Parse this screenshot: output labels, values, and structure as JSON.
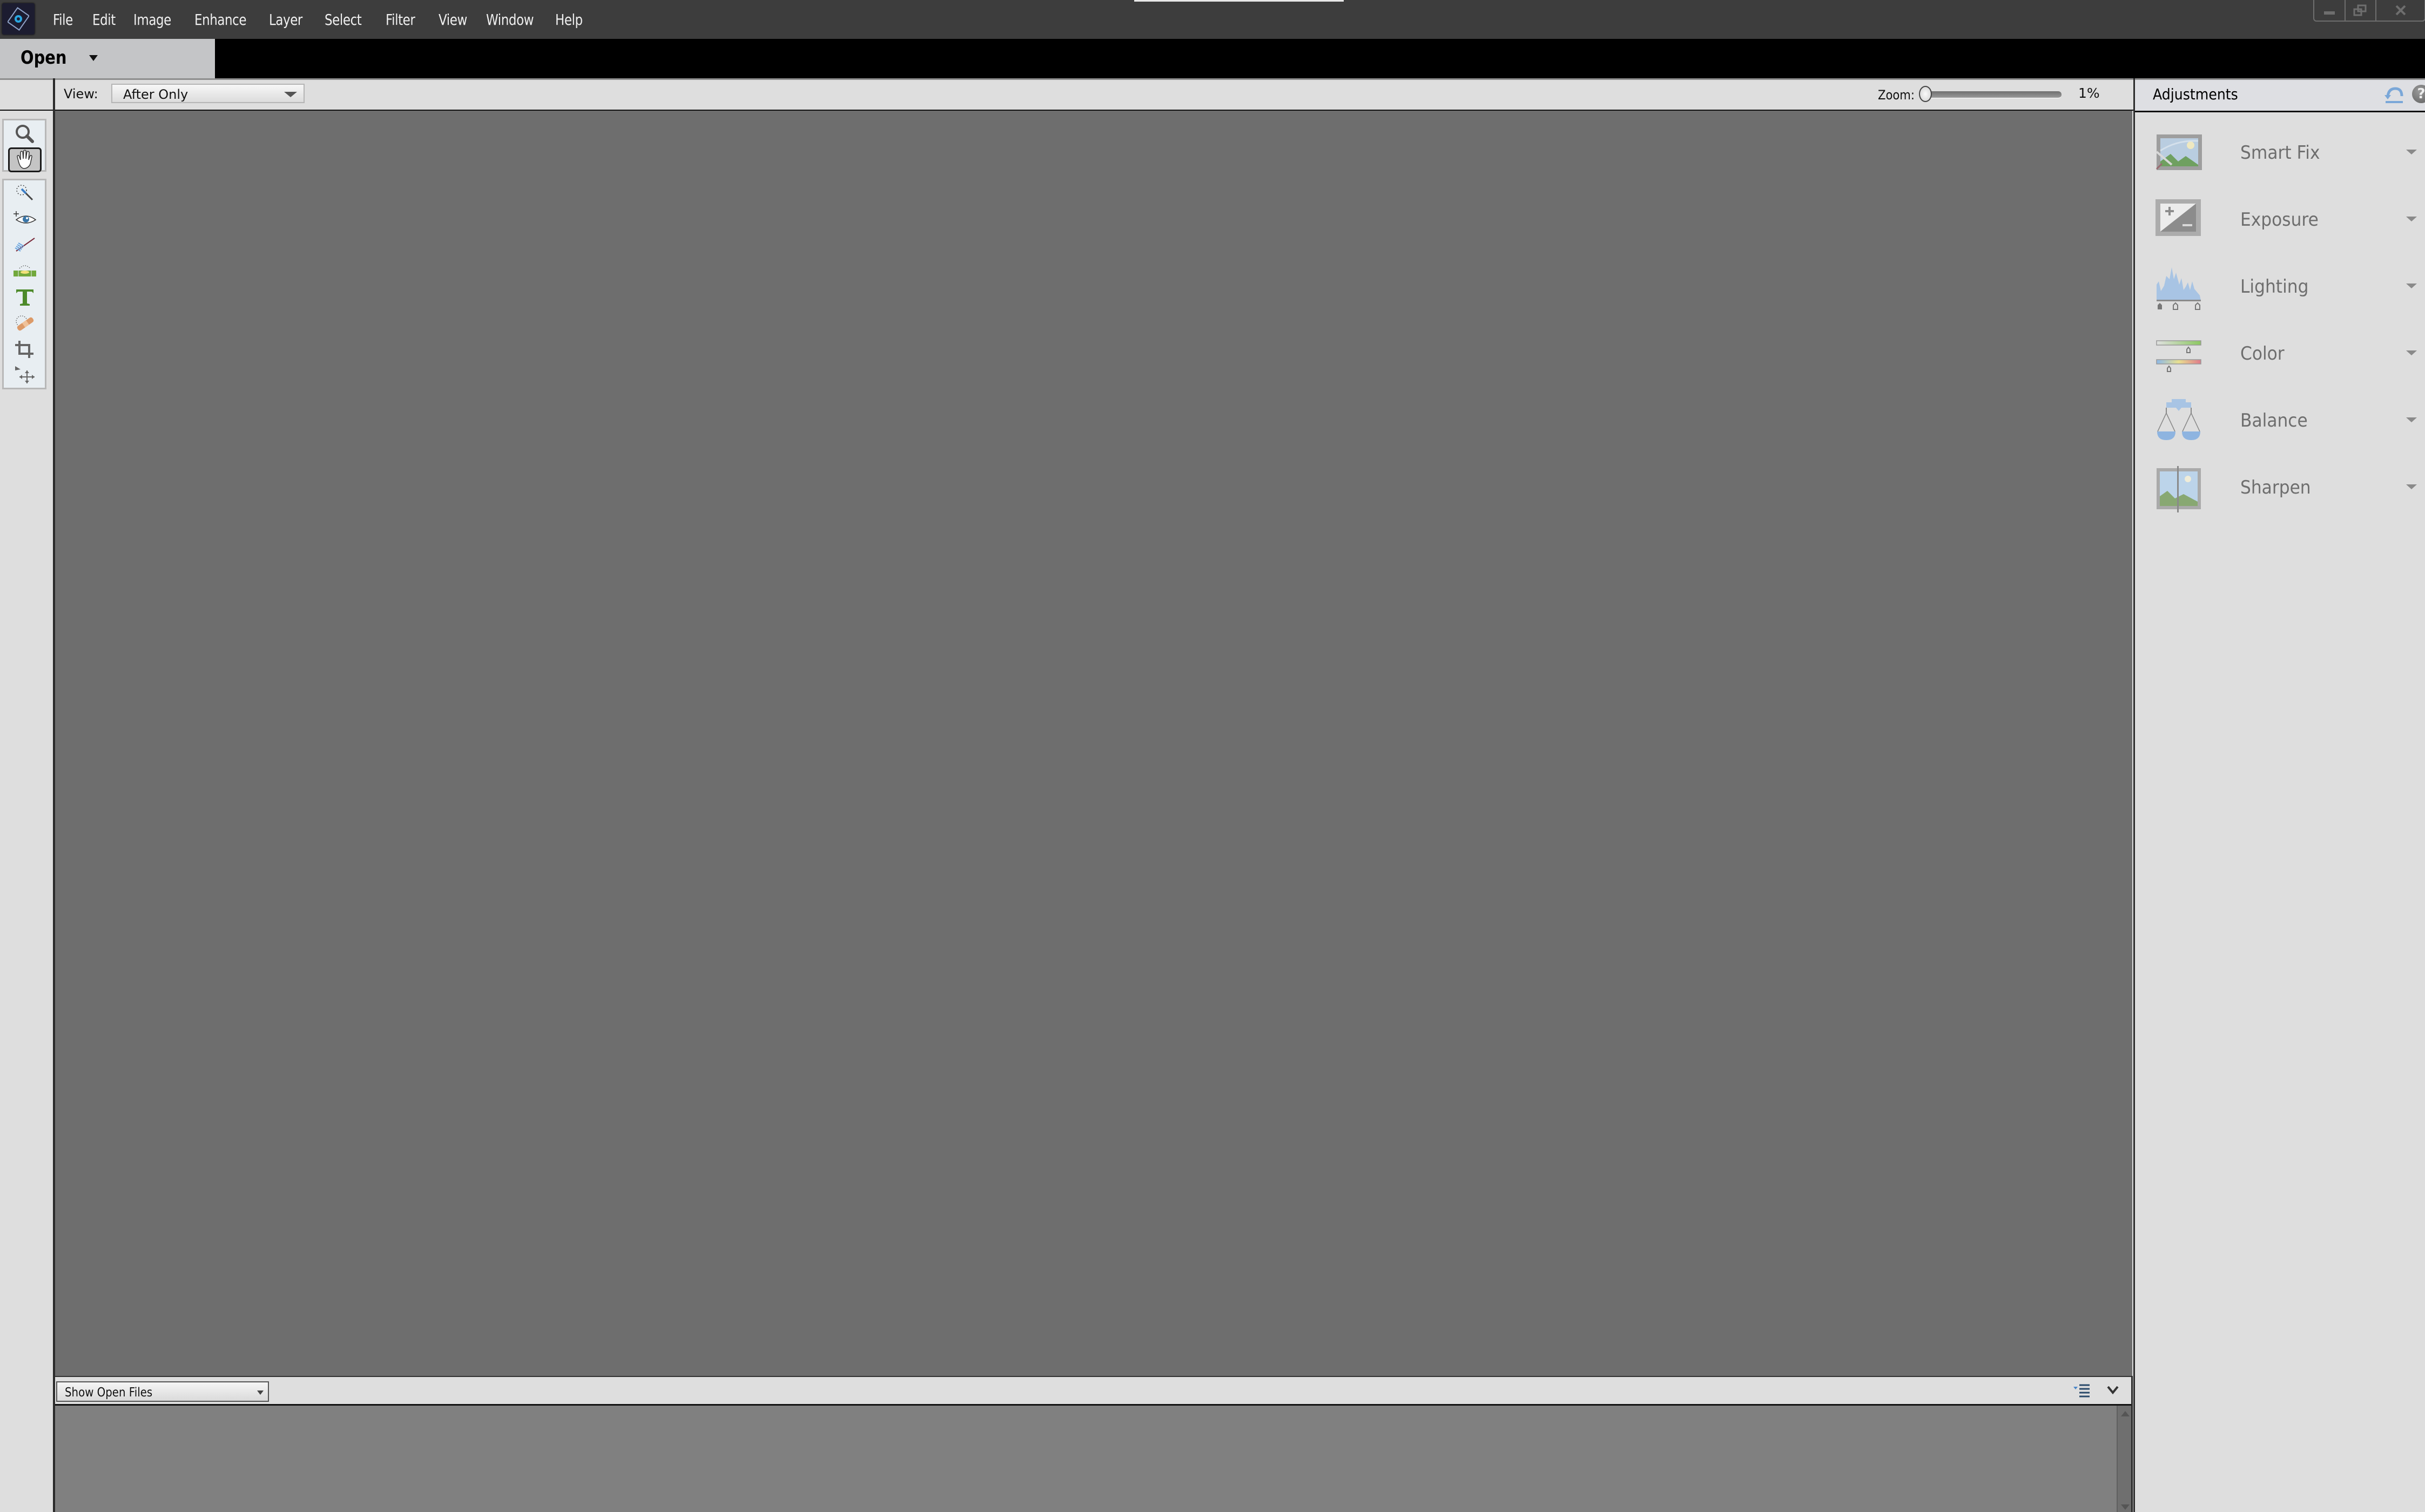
{
  "app": {
    "logo_icon": "photoshop-elements-logo-icon"
  },
  "menu": {
    "items": [
      "File",
      "Edit",
      "Image",
      "Enhance",
      "Layer",
      "Select",
      "Filter",
      "View",
      "Window",
      "Help"
    ]
  },
  "window_controls": {
    "minimize_icon": "minimize-icon",
    "restore_icon": "restore-icon",
    "close_icon": "close-icon"
  },
  "open_bar": {
    "open_label": "Open"
  },
  "options_bar": {
    "view_label": "View:",
    "view_value": "After Only",
    "zoom_label": "Zoom:",
    "zoom_value": "1%",
    "zoom_percent": 1
  },
  "tools": [
    {
      "name": "zoom-tool",
      "icon": "magnifier-icon",
      "active": false
    },
    {
      "name": "hand-tool",
      "icon": "hand-icon",
      "active": true
    },
    {
      "name": "quick-selection-tool",
      "icon": "quick-selection-icon",
      "active": false
    },
    {
      "name": "red-eye-removal-tool",
      "icon": "eye-icon",
      "active": false
    },
    {
      "name": "whiten-teeth-tool",
      "icon": "toothbrush-icon",
      "active": false
    },
    {
      "name": "straighten-tool",
      "icon": "level-icon",
      "active": false
    },
    {
      "name": "type-tool",
      "icon": "type-icon",
      "active": false
    },
    {
      "name": "spot-healing-brush-tool",
      "icon": "bandage-icon",
      "active": false
    },
    {
      "name": "crop-tool",
      "icon": "crop-icon",
      "active": false
    },
    {
      "name": "move-tool",
      "icon": "move-icon",
      "active": false
    }
  ],
  "panel": {
    "title": "Adjustments",
    "reset_icon": "reset-icon",
    "help_icon": "help-icon",
    "help_glyph": "?",
    "items": [
      {
        "label": "Smart Fix",
        "icon": "smart-fix-icon"
      },
      {
        "label": "Exposure",
        "icon": "exposure-icon"
      },
      {
        "label": "Lighting",
        "icon": "histogram-icon"
      },
      {
        "label": "Color",
        "icon": "color-sliders-icon"
      },
      {
        "label": "Balance",
        "icon": "scale-balance-icon"
      },
      {
        "label": "Sharpen",
        "icon": "sharpen-icon"
      }
    ]
  },
  "bottom_bar": {
    "files_select_value": "Show Open Files"
  },
  "colors": {
    "menubar_bg": "#3d3d3d",
    "canvas_bg": "#6e6e6e",
    "panel_bg": "#dedede",
    "photobin_bg": "#808080",
    "accent_blue": "#7aa7d8"
  }
}
